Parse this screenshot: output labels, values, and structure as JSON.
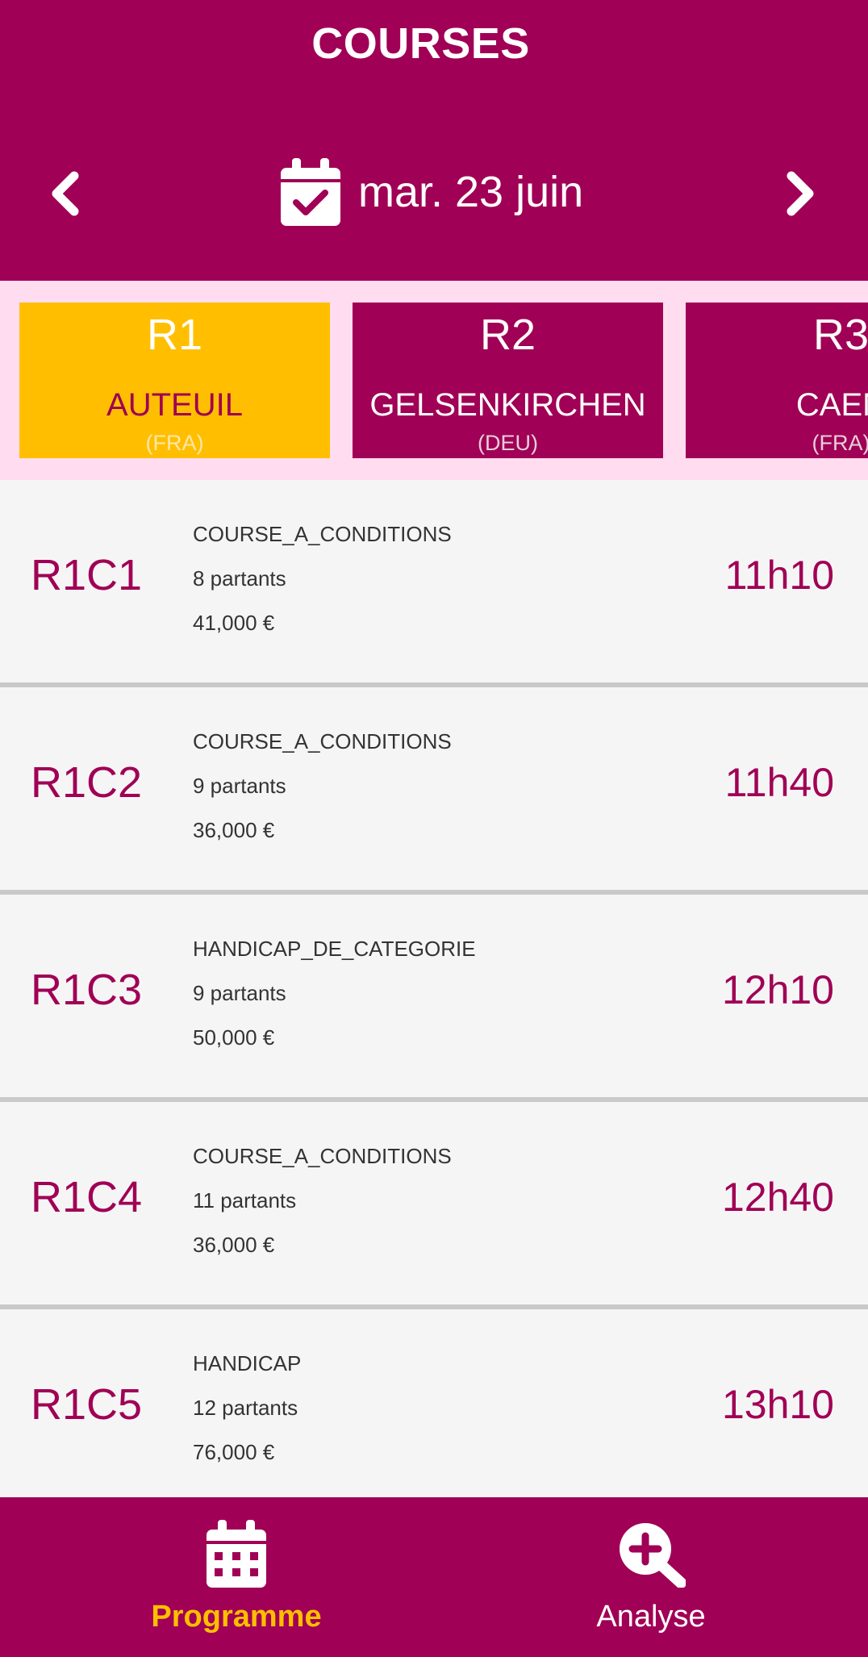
{
  "header": {
    "title": "COURSES",
    "date": "mar. 23 juin",
    "prev_icon": "chevron-left-icon",
    "next_icon": "chevron-right-icon",
    "date_icon": "calendar-check-icon"
  },
  "reunions": [
    {
      "code": "R1",
      "name": "AUTEUIL",
      "country": "(FRA)",
      "active": true
    },
    {
      "code": "R2",
      "name": "GELSENKIRCHEN",
      "country": "(DEU)",
      "active": false
    },
    {
      "code": "R3",
      "name": "CAEN",
      "country": "(FRA)",
      "active": false
    }
  ],
  "races": [
    {
      "id": "R1C1",
      "type": "COURSE_A_CONDITIONS",
      "partants": "8 partants",
      "prize": "41,000 €",
      "time": "11h10"
    },
    {
      "id": "R1C2",
      "type": "COURSE_A_CONDITIONS",
      "partants": "9 partants",
      "prize": "36,000 €",
      "time": "11h40"
    },
    {
      "id": "R1C3",
      "type": "HANDICAP_DE_CATEGORIE",
      "partants": "9 partants",
      "prize": "50,000 €",
      "time": "12h10"
    },
    {
      "id": "R1C4",
      "type": "COURSE_A_CONDITIONS",
      "partants": "11 partants",
      "prize": "36,000 €",
      "time": "12h40"
    },
    {
      "id": "R1C5",
      "type": "HANDICAP",
      "partants": "12 partants",
      "prize": "76,000 €",
      "time": "13h10"
    }
  ],
  "bottom_nav": {
    "programme": {
      "label": "Programme",
      "icon": "calendar-icon",
      "active": true
    },
    "analyse": {
      "label": "Analyse",
      "icon": "search-plus-icon",
      "active": false
    }
  },
  "colors": {
    "primary": "#a00055",
    "accent": "#ffbf00",
    "strip": "#ffdcef",
    "list_bg": "#f5f5f5"
  }
}
